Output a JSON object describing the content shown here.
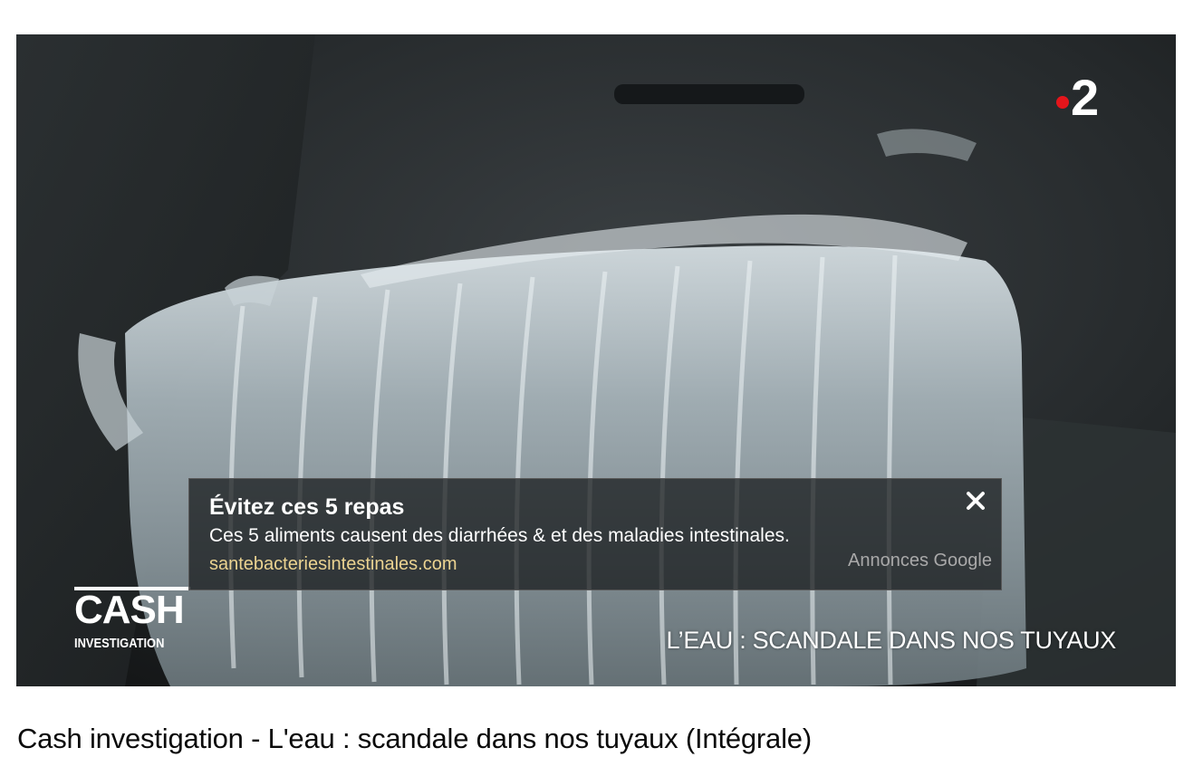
{
  "player": {
    "channel_logo": {
      "dot_color": "#e4151b",
      "number": "2"
    },
    "show_logo": {
      "main": "CASH",
      "sub": "INVESTIGATION"
    },
    "caption": "L’EAU : SCANDALE DANS NOS TUYAUX"
  },
  "ad": {
    "title": "Évitez ces 5 repas",
    "description": "Ces 5 aliments causent des diarrhées & et des maladies intestinales.",
    "url": "santebacteriesintestinales.com",
    "provider": "Annonces Google",
    "close_icon": "close-icon",
    "url_color": "#ebd391"
  },
  "video": {
    "title": "Cash investigation - L'eau : scandale dans nos tuyaux (Intégrale)"
  }
}
